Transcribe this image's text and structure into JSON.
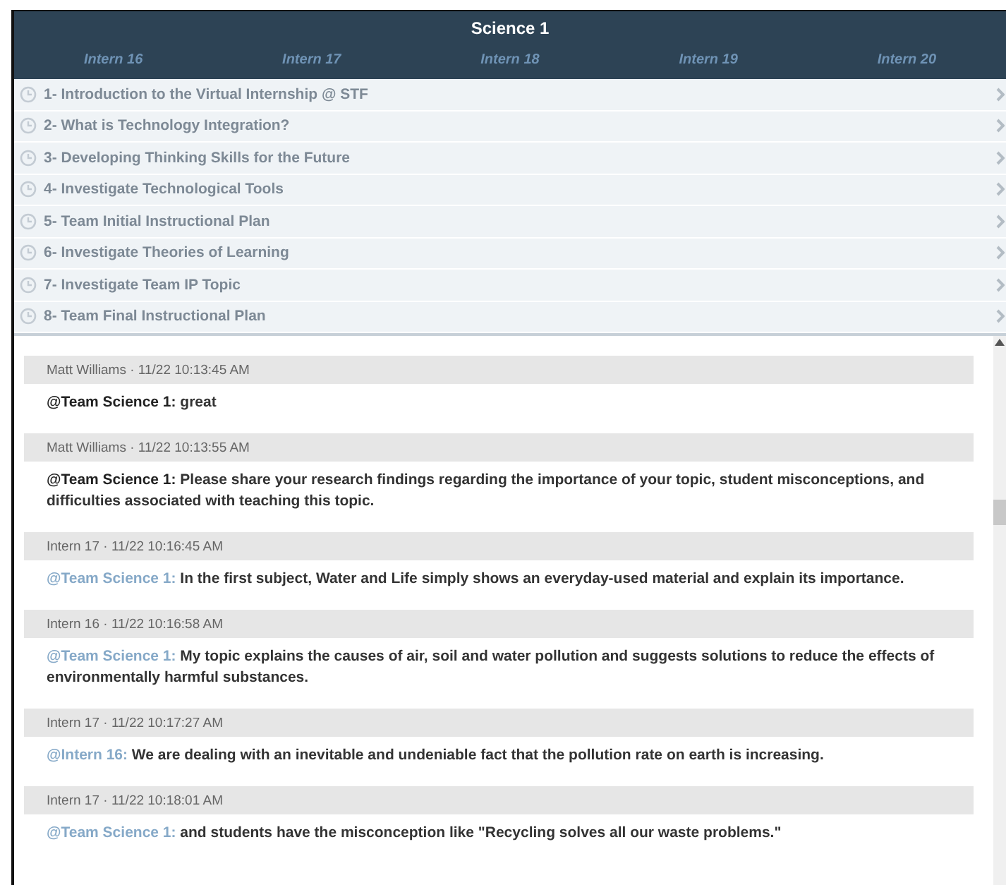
{
  "header": {
    "title": "Science 1",
    "interns": [
      "Intern 16",
      "Intern 17",
      "Intern 18",
      "Intern 19",
      "Intern 20"
    ]
  },
  "tasks": [
    {
      "label": "1- Introduction to the Virtual Internship @ STF"
    },
    {
      "label": "2- What is Technology Integration?"
    },
    {
      "label": "3- Developing Thinking Skills for the Future"
    },
    {
      "label": "4- Investigate Technological Tools"
    },
    {
      "label": "5- Team Initial Instructional Plan"
    },
    {
      "label": "6- Investigate Theories of Learning"
    },
    {
      "label": "7- Investigate Team IP Topic"
    },
    {
      "label": "8- Team Final Instructional Plan"
    }
  ],
  "messages": [
    {
      "kind": "staff",
      "meta": "Matt Williams · 11/22 10:13:45 AM",
      "mention": "@Team Science 1:",
      "text": "great"
    },
    {
      "kind": "staff",
      "meta": "Matt Williams · 11/22 10:13:55 AM",
      "mention": "@Team Science 1:",
      "text": "Please share your research findings regarding the importance of your topic, student misconceptions, and difficulties associated with teaching this topic."
    },
    {
      "kind": "intern",
      "meta": "Intern 17 · 11/22 10:16:45 AM",
      "mention": "@Team Science 1:",
      "text": "In the first subject, Water and Life simply shows an everyday-used material and explain its importance."
    },
    {
      "kind": "intern",
      "meta": "Intern 16 · 11/22 10:16:58 AM",
      "mention": "@Team Science 1:",
      "text": "My topic explains the causes of air, soil and water pollution and suggests solutions to reduce the effects of environmentally harmful substances."
    },
    {
      "kind": "intern",
      "meta": "Intern 17 · 11/22 10:17:27 AM",
      "mention": "@Intern 16:",
      "text": "We are dealing with an inevitable and undeniable fact that the pollution rate on earth is increasing."
    },
    {
      "kind": "intern",
      "meta": "Intern 17 · 11/22 10:18:01 AM",
      "mention": "@Team Science 1:",
      "text": "and students have the misconception like \"Recycling solves all our waste problems.\""
    }
  ]
}
